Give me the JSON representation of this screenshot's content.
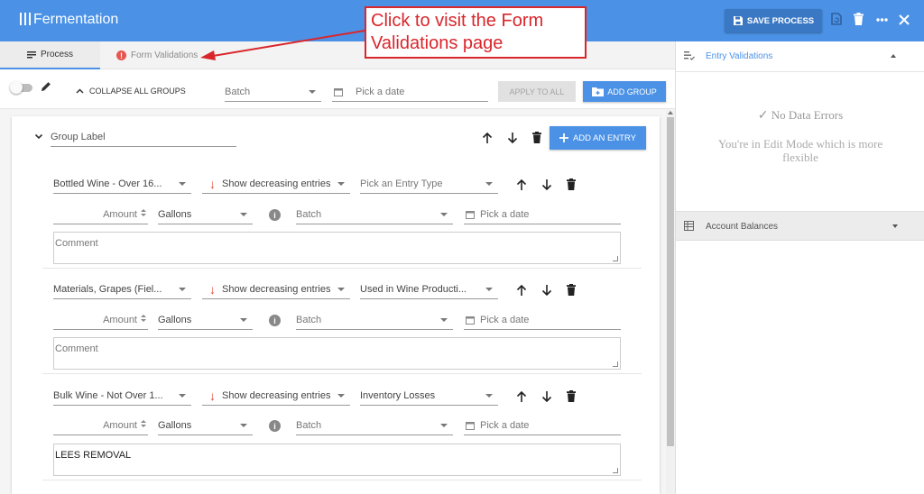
{
  "app": {
    "title": "Fermentation",
    "save_label": "SAVE PROCESS"
  },
  "tabs": [
    {
      "label": "Process"
    },
    {
      "label": "Form Validations"
    }
  ],
  "toolbar": {
    "collapse_label": "COLLAPSE ALL GROUPS",
    "batch_placeholder": "Batch",
    "date_placeholder": "Pick a date",
    "apply_label": "APPLY TO ALL",
    "add_group_label": "ADD GROUP"
  },
  "group": {
    "label": "Group Label",
    "add_entry_label": "ADD AN ENTRY"
  },
  "entries": [
    {
      "account": "Bottled Wine - Over 16...",
      "direction": "Show decreasing entries",
      "entry_type": "Pick an Entry Type",
      "amount_placeholder": "Amount",
      "unit": "Gallons",
      "batch": "Batch",
      "date": "Pick a date",
      "comment": "Comment",
      "comment_is_placeholder": true
    },
    {
      "account": "Materials, Grapes (Fiel...",
      "direction": "Show decreasing entries",
      "entry_type": "Used in Wine Producti...",
      "amount_placeholder": "Amount",
      "unit": "Gallons",
      "batch": "Batch",
      "date": "Pick a date",
      "comment": "Comment",
      "comment_is_placeholder": true
    },
    {
      "account": "Bulk Wine - Not Over 1...",
      "direction": "Show decreasing entries",
      "entry_type": "Inventory Losses",
      "amount_placeholder": "Amount",
      "unit": "Gallons",
      "batch": "Batch",
      "date": "Pick a date",
      "comment": "LEES REMOVAL",
      "comment_is_placeholder": false
    }
  ],
  "right_pane": {
    "entry_validations_label": "Entry Validations",
    "no_errors": "No Data Errors",
    "edit_mode_message": "You're in Edit Mode which is more flexible",
    "account_balances_label": "Account Balances"
  },
  "annotation": {
    "callout_text": "Click to visit the Form Validations page"
  },
  "colors": {
    "primary": "#4b92e6",
    "error": "#e7574f",
    "callout": "#d9262b"
  }
}
